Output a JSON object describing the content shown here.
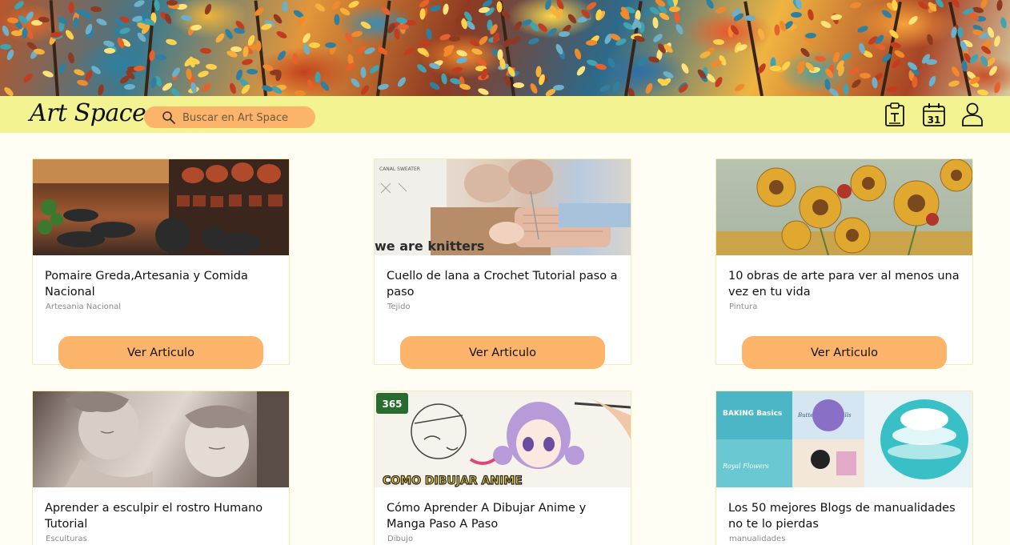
{
  "app": {
    "name": "Art Space"
  },
  "search": {
    "placeholder": "Buscar en Art Space"
  },
  "header_icons": [
    "notes-icon",
    "calendar-icon",
    "user-icon"
  ],
  "calendar_day": "31",
  "colors": {
    "header_bg": "#f4f391",
    "accent": "#fbb46a",
    "page_bg": "#fffdf4"
  },
  "articles": [
    {
      "title": "Pomaire Greda,Artesania y Comida Nacional",
      "category": "Artesania Nacional",
      "button": "Ver Articulo"
    },
    {
      "title": "Cuello de lana a Crochet Tutorial paso a paso",
      "category": "Tejido",
      "button": "Ver Articulo"
    },
    {
      "title": "10 obras de arte para ver al menos una vez en tu vida",
      "category": "Pintura",
      "button": "Ver Articulo"
    },
    {
      "title": "Aprender a esculpir el rostro Humano Tutorial",
      "category": "Esculturas",
      "button": "Ver Articulo"
    },
    {
      "title": "Cómo Aprender A Dibujar Anime y Manga Paso A Paso",
      "category": "Dibujo",
      "button": "Ver Articulo"
    },
    {
      "title": "Los 50 mejores Blogs de manualidades no te lo pierdas",
      "category": "manualidades",
      "button": "Ver Articulo"
    }
  ],
  "thumb_text": {
    "knit_label": "CANAL SWEATER",
    "knit_slogan": "we are knitters",
    "anime_badge": "365",
    "anime_caption": "COMO DIBUJAR ANIME",
    "blogs_label_1": "BAKING Basics",
    "blogs_label_2": "Buttercream Skills",
    "blogs_label_3": "Royal Flowers"
  }
}
